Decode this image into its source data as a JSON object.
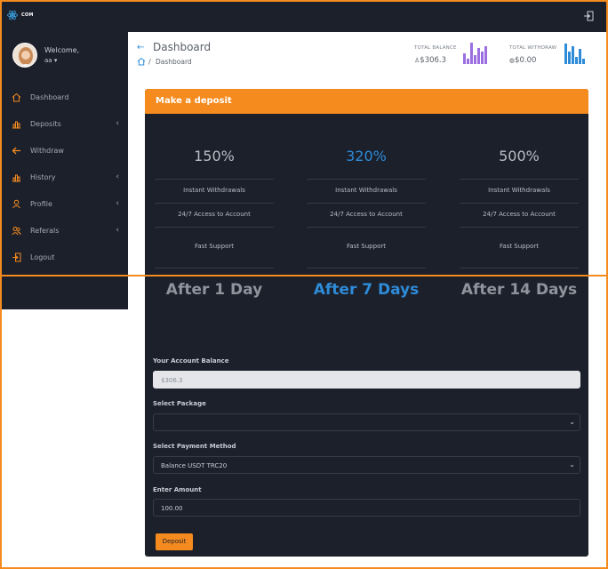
{
  "brand": {
    "text_a": "",
    "text_b": "COM"
  },
  "sidebar": {
    "welcome": "Welcome,",
    "user": "aa",
    "items": [
      {
        "label": "Dashboard",
        "icon": "home-icon",
        "has_chevron": false
      },
      {
        "label": "Deposits",
        "icon": "bar-chart-icon",
        "has_chevron": true
      },
      {
        "label": "Withdraw",
        "icon": "arrow-left-icon",
        "has_chevron": false
      },
      {
        "label": "History",
        "icon": "bar-chart-icon",
        "has_chevron": true
      },
      {
        "label": "Profile",
        "icon": "user-icon",
        "has_chevron": true
      },
      {
        "label": "Referals",
        "icon": "users-icon",
        "has_chevron": true
      },
      {
        "label": "Logout",
        "icon": "logout-icon",
        "has_chevron": false
      }
    ]
  },
  "header": {
    "title": "Dashboard",
    "breadcrumb": "Dashboard"
  },
  "stats": {
    "total_balance": {
      "label": "TOTAL BALANCE",
      "value": "$306.3",
      "color": "#9b6fe0"
    },
    "total_withdraw": {
      "label": "TOTAL WITHDRAW",
      "value": "$0.00",
      "color": "#2e8bd8"
    }
  },
  "deposit": {
    "title": "Make a deposit",
    "plans": [
      {
        "percent": "150%",
        "after": "After 1 Day",
        "highlight": false
      },
      {
        "percent": "320%",
        "after": "After 7 Days",
        "highlight": true
      },
      {
        "percent": "500%",
        "after": "After 14 Days",
        "highlight": false
      }
    ],
    "features": [
      "Instant Withdrawals",
      "24/7 Access to Account",
      "Fast Support"
    ],
    "form": {
      "balance_label": "Your Account Balance",
      "balance_value": "$306.3",
      "package_label": "Select Package",
      "package_value": "",
      "method_label": "Select Payment Method",
      "method_value": "Balance USDT TRC20",
      "amount_label": "Enter Amount",
      "amount_value": "100.00",
      "submit_label": "Deposit"
    }
  },
  "colors": {
    "accent": "#f58b1f",
    "highlight": "#2e8bd8",
    "panel": "#1c202b"
  }
}
